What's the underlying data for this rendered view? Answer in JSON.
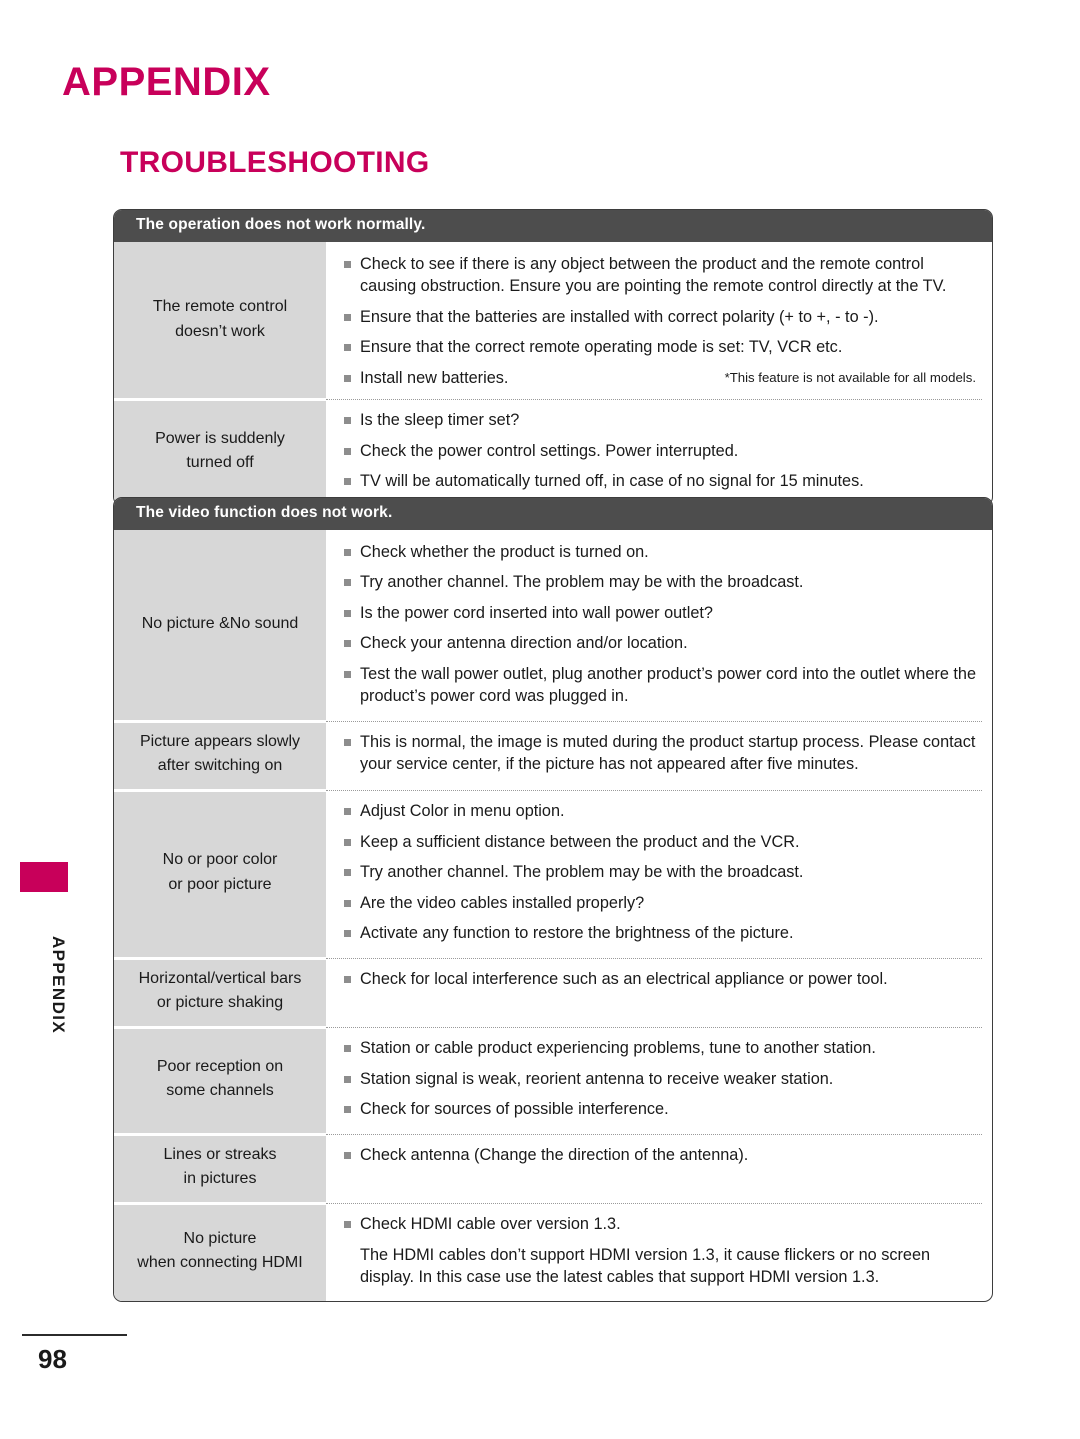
{
  "page": {
    "title": "APPENDIX",
    "section_title": "TROUBLESHOOTING",
    "number": "98",
    "side_tab_label": "APPENDIX",
    "accent_color": "#c8005a",
    "header_bar_color": "#4d4d4d",
    "label_cell_color": "#d7d7d7"
  },
  "tables": [
    {
      "header": "The operation does not work normally.",
      "rows": [
        {
          "label": "The remote control\ndoesn’t work",
          "items": [
            "Check to see if there is any object between the product and the remote control causing obstruction. Ensure you are pointing the remote control directly at the TV.",
            "Ensure that the batteries are installed with correct polarity (+ to +, - to -).",
            "Ensure that the correct remote operating mode is set: TV, VCR etc.",
            "Install new batteries."
          ],
          "footnote": "*This feature is not available for all models."
        },
        {
          "label": "Power is suddenly\nturned off",
          "items": [
            "Is the sleep timer set?",
            "Check the power control settings. Power interrupted.",
            "TV will be automatically turned off, in case of no signal for 15 minutes."
          ]
        }
      ]
    },
    {
      "header": "The video function does not work.",
      "rows": [
        {
          "label": "No picture &No sound",
          "items": [
            "Check whether the product is turned on.",
            "Try another channel. The problem may be with the broadcast.",
            "Is the power cord inserted into wall power outlet?",
            "Check your antenna direction and/or location.",
            "Test the wall power outlet, plug another product’s power cord into the outlet where the product’s power cord was plugged in."
          ]
        },
        {
          "label": "Picture appears slowly\nafter switching on",
          "items": [
            "This is normal, the image is muted during the product startup process. Please contact your service center, if the picture has not appeared after five minutes."
          ]
        },
        {
          "label": "No or poor color\nor poor picture",
          "items": [
            "Adjust Color in menu option.",
            "Keep a sufficient distance between the product and the VCR.",
            "Try another channel. The problem may be with the broadcast.",
            "Are the video cables installed properly?",
            "Activate any function to restore the brightness of the picture."
          ]
        },
        {
          "label": "Horizontal/vertical bars\nor picture shaking",
          "items": [
            "Check for local interference such as an electrical appliance or power tool."
          ]
        },
        {
          "label": "Poor reception on\nsome channels",
          "items": [
            "Station or cable product experiencing problems, tune to another station.",
            "Station signal is weak, reorient antenna to receive weaker station.",
            "Check for sources of possible interference."
          ]
        },
        {
          "label": "Lines or streaks\nin pictures",
          "items": [
            "Check antenna (Change the direction of the antenna)."
          ]
        },
        {
          "label": "No picture\nwhen connecting HDMI",
          "items": [
            "Check HDMI cable over version 1.3.",
            "The HDMI cables don’t support HDMI version 1.3, it cause flickers or no screen display. In this case use the latest cables that support HDMI version 1.3."
          ],
          "plain_items_from_index": 1
        }
      ]
    }
  ]
}
